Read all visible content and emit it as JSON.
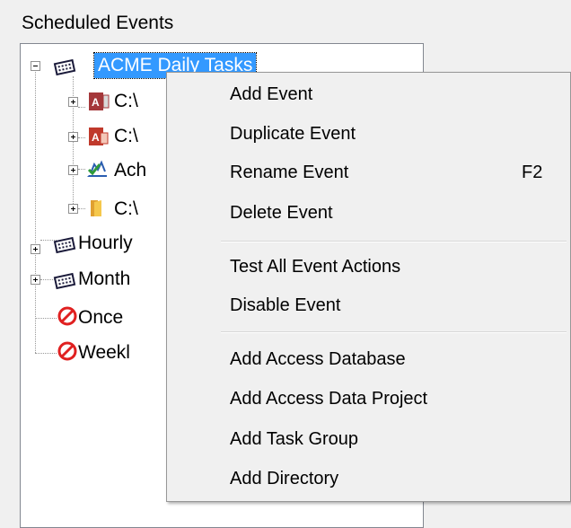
{
  "panel_title": "Scheduled Events",
  "tree": {
    "root": {
      "label": "ACME Daily Tasks",
      "icon": "calendar-icon"
    },
    "children": [
      {
        "label": "C:\\",
        "icon": "access-database-icon"
      },
      {
        "label": "C:\\",
        "icon": "access-data-project-icon"
      },
      {
        "label": "Ach",
        "icon": "task-group-icon"
      },
      {
        "label": "C:\\",
        "icon": "folder-icon"
      }
    ],
    "siblings": [
      {
        "label": "Hourly",
        "icon": "calendar-icon"
      },
      {
        "label": "Month",
        "icon": "calendar-icon"
      },
      {
        "label": "Once",
        "icon": "disabled-icon"
      },
      {
        "label": "Weekl",
        "icon": "disabled-icon"
      }
    ]
  },
  "context_menu": {
    "group1": [
      {
        "label": "Add Event",
        "shortcut": ""
      },
      {
        "label": "Duplicate Event",
        "shortcut": ""
      },
      {
        "label": "Rename Event",
        "shortcut": "F2"
      },
      {
        "label": "Delete Event",
        "shortcut": ""
      }
    ],
    "group2": [
      {
        "label": "Test All Event Actions",
        "shortcut": ""
      },
      {
        "label": "Disable Event",
        "shortcut": ""
      }
    ],
    "group3": [
      {
        "label": "Add Access Database",
        "shortcut": ""
      },
      {
        "label": "Add Access Data Project",
        "shortcut": ""
      },
      {
        "label": "Add Task Group",
        "shortcut": ""
      },
      {
        "label": "Add Directory",
        "shortcut": ""
      }
    ]
  },
  "colors": {
    "selection": "#3399ff",
    "menu_bg": "#f0f0f0",
    "window_bg": "#f0f0f0"
  }
}
